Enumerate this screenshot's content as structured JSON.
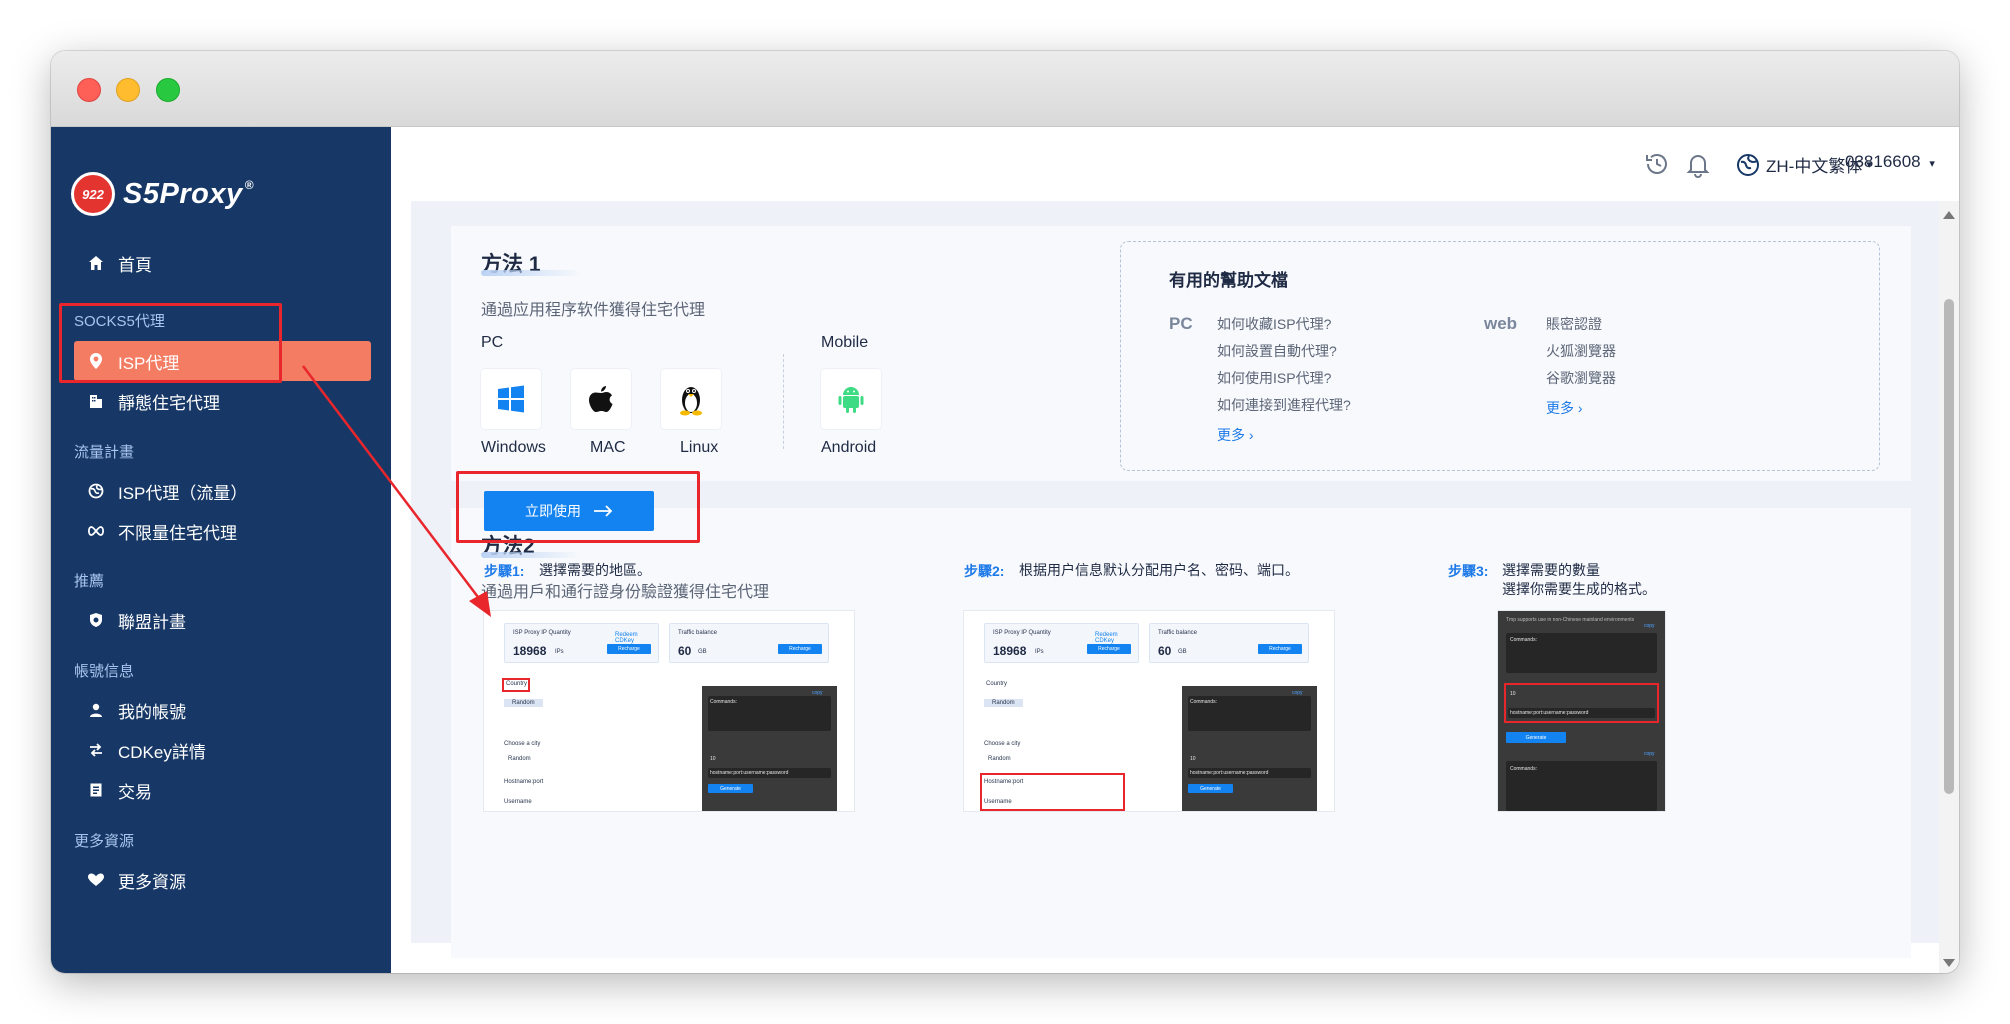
{
  "window": {
    "controls": [
      "close",
      "minimize",
      "zoom"
    ]
  },
  "logo": {
    "badge_text": "922",
    "brand": "S5Proxy",
    "reg": "®"
  },
  "sidebar": {
    "home": "首頁",
    "group_socks5": "SOCKS5代理",
    "isp_proxy": "ISP代理",
    "static_residential": "靜態住宅代理",
    "group_traffic": "流量計畫",
    "isp_traffic": "ISP代理（流量）",
    "unlimited_residential": "不限量住宅代理",
    "group_promo": "推薦",
    "affiliate": "聯盟計畫",
    "group_account": "帳號信息",
    "my_account": "我的帳號",
    "cdkey": "CDKey詳情",
    "transactions": "交易",
    "group_more": "更多資源",
    "more_resources": "更多資源"
  },
  "header": {
    "history_icon": "history-icon",
    "bell_icon": "bell-icon",
    "language": "ZH-中文繁体",
    "user_id": "03816608"
  },
  "method1": {
    "title": "方法 1",
    "desc": "通過应用程序软件獲得住宅代理",
    "pc_label": "PC",
    "mobile_label": "Mobile",
    "os": [
      "Windows",
      "MAC",
      "Linux",
      "Android"
    ]
  },
  "help": {
    "title": "有用的幫助文檔",
    "pc_tag": "PC",
    "web_tag": "web",
    "pc_links": [
      "如何收藏ISP代理?",
      "如何設置自動代理?",
      "如何使用ISP代理?",
      "如何連接到進程代理?"
    ],
    "pc_more": "更多 ›",
    "web_links": [
      "賬密認證",
      "火狐瀏覽器",
      "谷歌瀏覽器"
    ],
    "web_more": "更多 ›"
  },
  "method2": {
    "title": "方法2",
    "desc": "通過用戶和通行證身份驗證獲得住宅代理",
    "cta": "立即使用",
    "steps": [
      {
        "label": "步驟1:",
        "text": "選擇需要的地區。"
      },
      {
        "label": "步驟2:",
        "text": "根据用户信息默认分配用户名、密码、端口。"
      },
      {
        "label": "步驟3:",
        "text": "選擇需要的數量",
        "text2": "選擇你需要生成的格式。"
      }
    ]
  },
  "mini": {
    "isp_qty_label": "ISP Proxy IP Quantity",
    "isp_qty_value": "18968",
    "isp_qty_unit": "IPs",
    "redeem": "Redeem CDKey",
    "recharge": "Recharge",
    "traffic_label": "Traffic balance",
    "traffic_value": "60",
    "traffic_unit": "GB",
    "country": "Country",
    "choose_city": "Choose a city",
    "random": "Random",
    "hostname_port": "Hostname:port",
    "username": "Username",
    "commands": "Commands:",
    "generate": "Generate",
    "copy": "copy",
    "format": "hostname:port:username:password",
    "qty": "10",
    "tip": "Tmp supports use in non-Chinese mainland environments"
  }
}
